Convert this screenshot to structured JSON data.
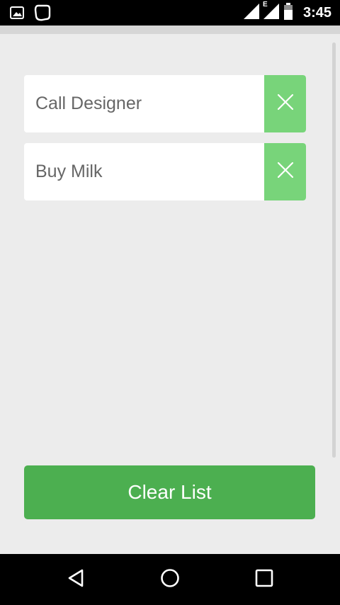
{
  "status_bar": {
    "time": "3:45",
    "icons": [
      "image-icon",
      "chat-bubble-icon",
      "signal-icon",
      "lte-signal-icon",
      "battery-icon"
    ],
    "network_label": "E"
  },
  "todos": [
    {
      "text": "Call Designer",
      "remove_icon": "close-icon"
    },
    {
      "text": "Buy Milk",
      "remove_icon": "close-icon"
    }
  ],
  "actions": {
    "clear_label": "Clear List"
  },
  "nav": {
    "icons": [
      "back-icon",
      "home-icon",
      "recents-icon"
    ]
  },
  "colors": {
    "accent": "#4caf50",
    "remove_bg": "#78d47a",
    "background": "#ececec"
  }
}
